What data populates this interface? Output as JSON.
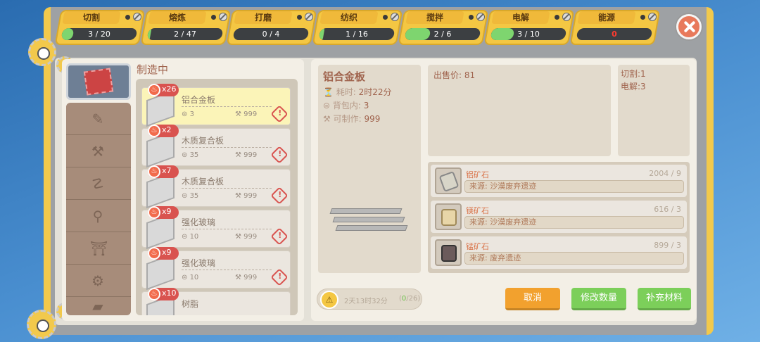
{
  "tabs": [
    {
      "label": "切割",
      "progress": "3 / 20",
      "fill": 0.15
    },
    {
      "label": "熔炼",
      "progress": "2 / 47",
      "fill": 0.04
    },
    {
      "label": "打磨",
      "progress": "0 / 4",
      "fill": 0
    },
    {
      "label": "纺织",
      "progress": "1 / 16",
      "fill": 0.06
    },
    {
      "label": "搅拌",
      "progress": "2 / 6",
      "fill": 0.33
    },
    {
      "label": "电解",
      "progress": "3 / 10",
      "fill": 0.3
    },
    {
      "label": "能源",
      "progress": "0",
      "fill": 0
    }
  ],
  "section_title": "制造中",
  "queue": [
    {
      "count": "x26",
      "name": "铝合金板",
      "bag": "3",
      "craftable": "999",
      "selected": true
    },
    {
      "count": "x2",
      "name": "木质复合板",
      "bag": "35",
      "craftable": "999"
    },
    {
      "count": "x7",
      "name": "木质复合板",
      "bag": "35",
      "craftable": "999"
    },
    {
      "count": "x9",
      "name": "强化玻璃",
      "bag": "10",
      "craftable": "999"
    },
    {
      "count": "x9",
      "name": "强化玻璃",
      "bag": "10",
      "craftable": "999"
    },
    {
      "count": "x10",
      "name": "树脂",
      "bag": "",
      "craftable": ""
    }
  ],
  "detail": {
    "title": "铝合金板",
    "time_label": "耗时:",
    "time_value": "2时22分",
    "bag_label": "背包内:",
    "bag_value": "3",
    "craft_label": "可制作:",
    "craft_value": "999"
  },
  "price": "出售价: 81",
  "costs": [
    "切割:1",
    "电解:3"
  ],
  "materials": [
    {
      "name": "铝矿石",
      "count": "2004 / 9",
      "source": "来源: 沙漠废弃遗迹",
      "color": "#d8d5c8"
    },
    {
      "name": "镁矿石",
      "count": "616 / 3",
      "source": "来源: 沙漠废弃遗迹",
      "color": "#e8d6a8"
    },
    {
      "name": "锰矿石",
      "count": "899 / 3",
      "source": "来源: 废弃遗迹",
      "color": "#6b5b5b"
    }
  ],
  "status": {
    "time": "2天13时32分",
    "done": "0",
    "total": "/26)",
    "open": "("
  },
  "buttons": {
    "cancel": "取消",
    "modify": "修改数量",
    "refill": "补充材料"
  }
}
